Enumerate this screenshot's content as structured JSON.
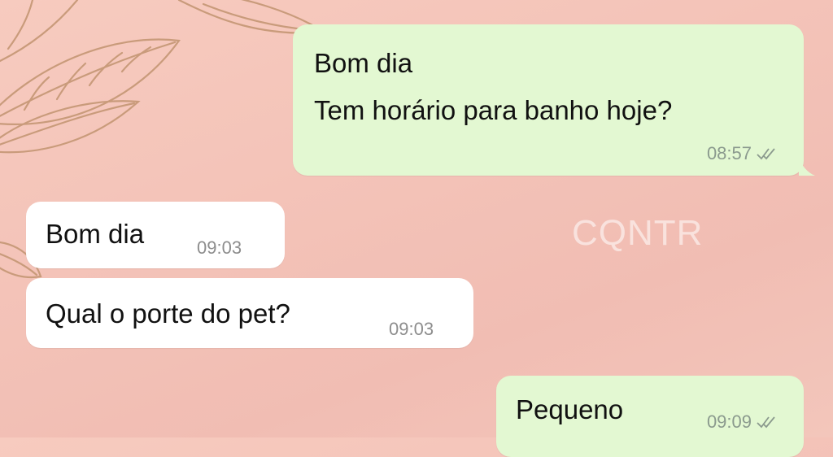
{
  "watermark": "CQNTR",
  "messages": [
    {
      "direction": "outgoing",
      "lines": [
        "Bom dia",
        "Tem horário para banho hoje?"
      ],
      "time": "08:57",
      "status": "read-ticks-icon"
    },
    {
      "direction": "incoming",
      "text": "Bom dia",
      "time": "09:03"
    },
    {
      "direction": "incoming",
      "text": "Qual o porte do pet?",
      "time": "09:03"
    },
    {
      "direction": "outgoing",
      "text": "Pequeno",
      "time": "09:09",
      "status": "read-ticks-icon"
    }
  ],
  "colors": {
    "outgoing_bubble": "#e3f8d2",
    "incoming_bubble": "#ffffff",
    "background": "#f4c4b9",
    "leaf_stroke": "#c89a78"
  }
}
